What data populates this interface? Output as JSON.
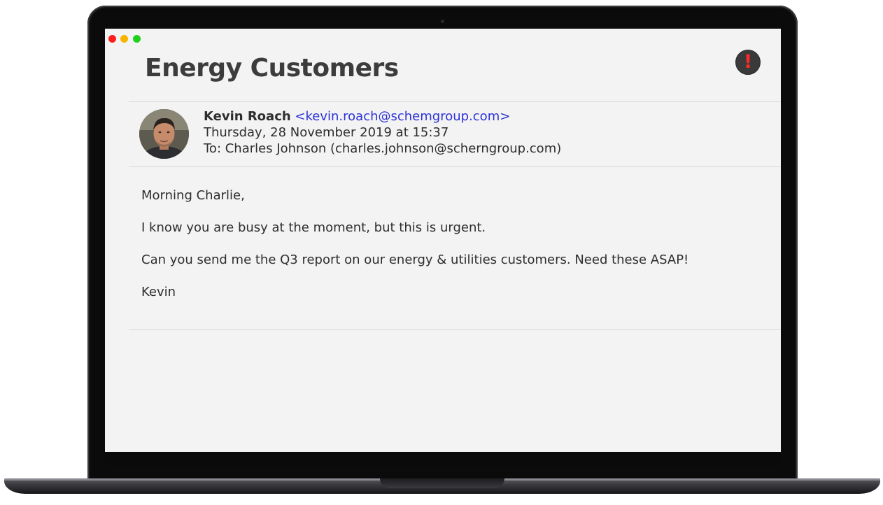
{
  "window": {
    "controls": [
      "close",
      "minimize",
      "maximize"
    ],
    "colors": {
      "close": "#ff1d1d",
      "minimize": "#f6b400",
      "maximize": "#1fd11f"
    }
  },
  "email": {
    "subject": "Energy Customers",
    "flag_icon": "exclamation-icon",
    "flag_label": "!",
    "flag_color": "#ff2a2a",
    "sender": {
      "name": "Kevin Roach",
      "email": "<kevin.roach@schemgroup.com>",
      "avatar": "photo of Kevin Roach"
    },
    "date": "Thursday, 28 November 2019 at 15:37",
    "to": "To: Charles Johnson (charles.johnson@scherngroup.com)",
    "body": [
      "Morning Charlie,",
      "I know you are busy at the moment, but this is urgent.",
      "Can you send me the Q3 report on our energy & utilities customers. Need these ASAP!",
      "Kevin"
    ],
    "link_color": "#2d32d6"
  }
}
